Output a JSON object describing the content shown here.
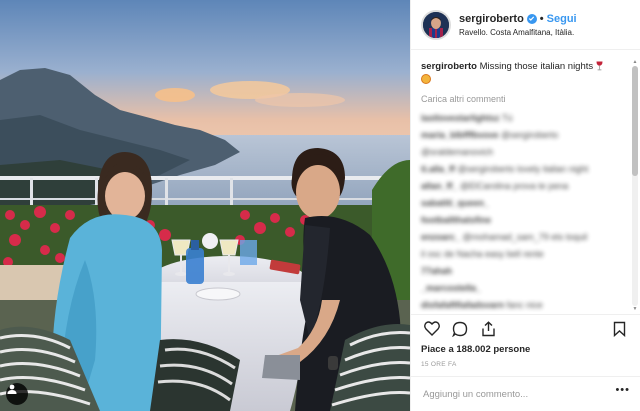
{
  "post": {
    "username": "sergiroberto",
    "follow_label": "Segui",
    "separator": "•",
    "location": "Ravello. Costa Amalfitana, Itàlia.",
    "caption": {
      "username": "sergiroberto",
      "text": "Missing those italian nights"
    },
    "load_more_label": "Carica altri commenti",
    "comments": [
      {
        "user": "lastlovestarlightsz",
        "text": "Tú"
      },
      {
        "user": "maria_blbfffbvove",
        "text": "@sergiroberto"
      },
      {
        "user": "",
        "text": "@sraldemanovich"
      },
      {
        "user": "ti.alla_ff",
        "text": "@sergiroberto lovely italian night"
      },
      {
        "user": "allan_ff_",
        "text": "@ElCarolina prova te pena"
      },
      {
        "user": "sabatiti_queen_",
        "text": ""
      },
      {
        "user": "footballthatsfine",
        "text": ""
      },
      {
        "user": "enzoarc_",
        "text": "@mohamad_sam_79 ets toquil"
      },
      {
        "user": "",
        "text": "il osc de Nacha easy bell rente"
      },
      {
        "user": "77ahah",
        "text": ""
      },
      {
        "user": "_marcostella_",
        "text": ""
      },
      {
        "user": "disfafaftfiafadsvarn",
        "text": "fanc nice"
      },
      {
        "user": "sanaychlt",
        "text": ""
      }
    ],
    "likes": "Piace a 188.002 persone",
    "time": "15 ORE FA",
    "comment_placeholder": "Aggiungi un commento...",
    "more_label": "•••"
  },
  "colors": {
    "accent": "#3897f0",
    "text": "#262626",
    "muted": "#999999",
    "border": "#efefef"
  }
}
